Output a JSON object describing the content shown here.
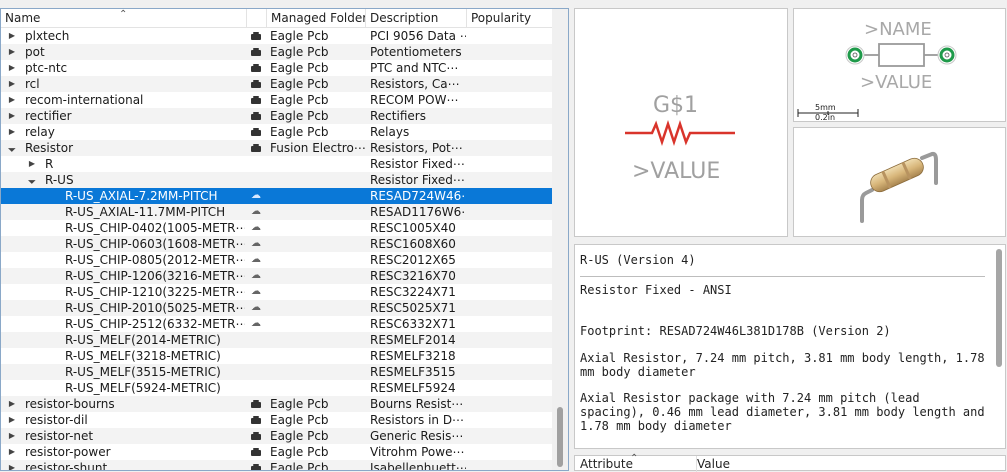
{
  "tree": {
    "columns": {
      "name": "Name",
      "managed_folder": "Managed Folder",
      "description": "Description",
      "popularity": "Popularity"
    },
    "rows": [
      {
        "level": 0,
        "twisty": "collapsed",
        "name": "plxtech",
        "folder_icon": "storage-icon",
        "folder": "Eagle Pcb",
        "desc": "PCI 9056 Data ⋯"
      },
      {
        "level": 0,
        "twisty": "collapsed",
        "name": "pot",
        "folder_icon": "storage-icon",
        "folder": "Eagle Pcb",
        "desc": "Potentiometers"
      },
      {
        "level": 0,
        "twisty": "collapsed",
        "name": "ptc-ntc",
        "folder_icon": "storage-icon",
        "folder": "Eagle Pcb",
        "desc": "PTC and NTC⋯"
      },
      {
        "level": 0,
        "twisty": "collapsed",
        "name": "rcl",
        "folder_icon": "storage-icon",
        "folder": "Eagle Pcb",
        "desc": "Resistors, Ca⋯"
      },
      {
        "level": 0,
        "twisty": "collapsed",
        "name": "recom-international",
        "folder_icon": "storage-icon",
        "folder": "Eagle Pcb",
        "desc": "RECOM POW⋯"
      },
      {
        "level": 0,
        "twisty": "collapsed",
        "name": "rectifier",
        "folder_icon": "storage-icon",
        "folder": "Eagle Pcb",
        "desc": "Rectifiers"
      },
      {
        "level": 0,
        "twisty": "collapsed",
        "name": "relay",
        "folder_icon": "storage-icon",
        "folder": "Eagle Pcb",
        "desc": "Relays"
      },
      {
        "level": 0,
        "twisty": "expanded",
        "name": "Resistor",
        "folder_icon": "storage-icon",
        "folder": "Fusion Electro⋯",
        "desc": "Resistors, Pot⋯"
      },
      {
        "level": 1,
        "twisty": "collapsed",
        "name": "R",
        "folder_icon": "",
        "folder": "",
        "desc": "Resistor Fixed⋯"
      },
      {
        "level": 1,
        "twisty": "expanded",
        "name": "R-US",
        "folder_icon": "",
        "folder": "",
        "desc": "Resistor Fixed⋯"
      },
      {
        "level": 2,
        "twisty": "",
        "name": "R-US_AXIAL-7.2MM-PITCH",
        "folder_icon": "cloud-icon",
        "folder": "",
        "desc": "RESAD724W46⋯",
        "selected": true
      },
      {
        "level": 2,
        "twisty": "",
        "name": "R-US_AXIAL-11.7MM-PITCH",
        "folder_icon": "cloud-icon",
        "folder": "",
        "desc": "RESAD1176W6⋯"
      },
      {
        "level": 2,
        "twisty": "",
        "name": "R-US_CHIP-0402(1005-METR⋯",
        "folder_icon": "cloud-icon",
        "folder": "",
        "desc": "RESC1005X40"
      },
      {
        "level": 2,
        "twisty": "",
        "name": "R-US_CHIP-0603(1608-METR⋯",
        "folder_icon": "cloud-icon",
        "folder": "",
        "desc": "RESC1608X60"
      },
      {
        "level": 2,
        "twisty": "",
        "name": "R-US_CHIP-0805(2012-METR⋯",
        "folder_icon": "cloud-icon",
        "folder": "",
        "desc": "RESC2012X65"
      },
      {
        "level": 2,
        "twisty": "",
        "name": "R-US_CHIP-1206(3216-METR⋯",
        "folder_icon": "cloud-icon",
        "folder": "",
        "desc": "RESC3216X70"
      },
      {
        "level": 2,
        "twisty": "",
        "name": "R-US_CHIP-1210(3225-METR⋯",
        "folder_icon": "cloud-icon",
        "folder": "",
        "desc": "RESC3224X71"
      },
      {
        "level": 2,
        "twisty": "",
        "name": "R-US_CHIP-2010(5025-METR⋯",
        "folder_icon": "cloud-icon",
        "folder": "",
        "desc": "RESC5025X71"
      },
      {
        "level": 2,
        "twisty": "",
        "name": "R-US_CHIP-2512(6332-METR⋯",
        "folder_icon": "cloud-icon",
        "folder": "",
        "desc": "RESC6332X71"
      },
      {
        "level": 2,
        "twisty": "",
        "name": "R-US_MELF(2014-METRIC)",
        "folder_icon": "",
        "folder": "",
        "desc": "RESMELF2014"
      },
      {
        "level": 2,
        "twisty": "",
        "name": "R-US_MELF(3218-METRIC)",
        "folder_icon": "",
        "folder": "",
        "desc": "RESMELF3218"
      },
      {
        "level": 2,
        "twisty": "",
        "name": "R-US_MELF(3515-METRIC)",
        "folder_icon": "",
        "folder": "",
        "desc": "RESMELF3515"
      },
      {
        "level": 2,
        "twisty": "",
        "name": "R-US_MELF(5924-METRIC)",
        "folder_icon": "",
        "folder": "",
        "desc": "RESMELF5924"
      },
      {
        "level": 0,
        "twisty": "collapsed",
        "name": "resistor-bourns",
        "folder_icon": "storage-icon",
        "folder": "Eagle Pcb",
        "desc": "Bourns Resist⋯"
      },
      {
        "level": 0,
        "twisty": "collapsed",
        "name": "resistor-dil",
        "folder_icon": "storage-icon",
        "folder": "Eagle Pcb",
        "desc": "Resistors in D⋯"
      },
      {
        "level": 0,
        "twisty": "collapsed",
        "name": "resistor-net",
        "folder_icon": "storage-icon",
        "folder": "Eagle Pcb",
        "desc": "Generic Resis⋯"
      },
      {
        "level": 0,
        "twisty": "collapsed",
        "name": "resistor-power",
        "folder_icon": "storage-icon",
        "folder": "Eagle Pcb",
        "desc": "Vitrohm Powe⋯"
      },
      {
        "level": 0,
        "twisty": "collapsed",
        "name": "resistor-shunt",
        "folder_icon": "storage-icon",
        "folder": "Eagle Pcb",
        "desc": "Isabellenhuett⋯"
      }
    ]
  },
  "symbol_preview": {
    "name_label": "G$1",
    "value_label": ">VALUE",
    "resistor_color": "#d9342b",
    "text_color": "#a0a0a0"
  },
  "package_preview": {
    "name_label": ">NAME",
    "value_label": ">VALUE",
    "scale_mm": "5mm",
    "scale_in": "0.2in",
    "pad_color": "#1f9a4a"
  },
  "details": {
    "title": "R-US (Version 4)",
    "subtitle": "Resistor Fixed - ANSI",
    "footprint": "Footprint: RESAD724W46L381D178B (Version 2)",
    "para1": "Axial Resistor, 7.24 mm pitch, 3.81 mm body length, 1.78 mm body diameter",
    "para2": "Axial Resistor package with 7.24 mm pitch (lead spacing), 0.46 mm lead diameter, 3.81 mm body length and 1.78 mm body diameter"
  },
  "attributes": {
    "col_attribute": "Attribute",
    "col_value": "Value"
  }
}
